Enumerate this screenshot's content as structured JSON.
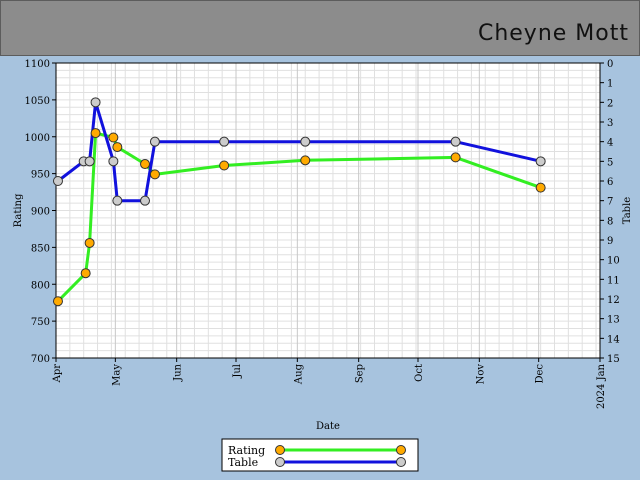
{
  "header": {
    "name": "Cheyne Mott"
  },
  "colors": {
    "rating": "#33ee22",
    "table": "#1111dd",
    "rating_marker": "#ffaa00",
    "table_marker": "#cccccc",
    "grid": "#e0e0e0"
  },
  "chart_data": {
    "type": "line",
    "title": "",
    "xlabel": "Date",
    "ylabel_left": "Rating",
    "ylabel_right": "Table",
    "x_ticks": [
      {
        "label": "Apr",
        "date": "2023-04-01"
      },
      {
        "label": "May",
        "date": "2023-05-01"
      },
      {
        "label": "Jun",
        "date": "2023-06-01"
      },
      {
        "label": "Jul",
        "date": "2023-07-01"
      },
      {
        "label": "Aug",
        "date": "2023-08-01"
      },
      {
        "label": "Sep",
        "date": "2023-09-01"
      },
      {
        "label": "Oct",
        "date": "2023-10-01"
      },
      {
        "label": "Nov",
        "date": "2023-11-01"
      },
      {
        "label": "Dec",
        "date": "2023-12-01"
      },
      {
        "label": "2024 Jan",
        "date": "2024-01-01"
      }
    ],
    "xlim": [
      "2023-04-01",
      "2024-01-01"
    ],
    "ylim_left": [
      700,
      1100
    ],
    "yticks_left": [
      700,
      750,
      800,
      850,
      900,
      950,
      1000,
      1050,
      1100
    ],
    "ylim_right": [
      15,
      0
    ],
    "yticks_right": [
      0,
      1,
      2,
      3,
      4,
      5,
      6,
      7,
      8,
      9,
      10,
      11,
      12,
      13,
      14,
      15
    ],
    "grid": true,
    "legend_position": "bottom-center",
    "series": [
      {
        "name": "Rating",
        "axis": "left",
        "points": [
          {
            "x": "2023-04-02",
            "y": 777
          },
          {
            "x": "2023-04-16",
            "y": 815
          },
          {
            "x": "2023-04-18",
            "y": 856
          },
          {
            "x": "2023-04-21",
            "y": 1005
          },
          {
            "x": "2023-04-30",
            "y": 999
          },
          {
            "x": "2023-05-02",
            "y": 986
          },
          {
            "x": "2023-05-16",
            "y": 963
          },
          {
            "x": "2023-05-21",
            "y": 949
          },
          {
            "x": "2023-06-25",
            "y": 961
          },
          {
            "x": "2023-08-05",
            "y": 968
          },
          {
            "x": "2023-10-20",
            "y": 972
          },
          {
            "x": "2023-12-02",
            "y": 931
          }
        ]
      },
      {
        "name": "Table",
        "axis": "right",
        "points": [
          {
            "x": "2023-04-02",
            "y": 6
          },
          {
            "x": "2023-04-15",
            "y": 5
          },
          {
            "x": "2023-04-18",
            "y": 5
          },
          {
            "x": "2023-04-21",
            "y": 2
          },
          {
            "x": "2023-04-30",
            "y": 5
          },
          {
            "x": "2023-05-02",
            "y": 7
          },
          {
            "x": "2023-05-16",
            "y": 7
          },
          {
            "x": "2023-05-21",
            "y": 4
          },
          {
            "x": "2023-06-25",
            "y": 4
          },
          {
            "x": "2023-08-05",
            "y": 4
          },
          {
            "x": "2023-10-20",
            "y": 4
          },
          {
            "x": "2023-12-02",
            "y": 5
          }
        ]
      }
    ]
  }
}
